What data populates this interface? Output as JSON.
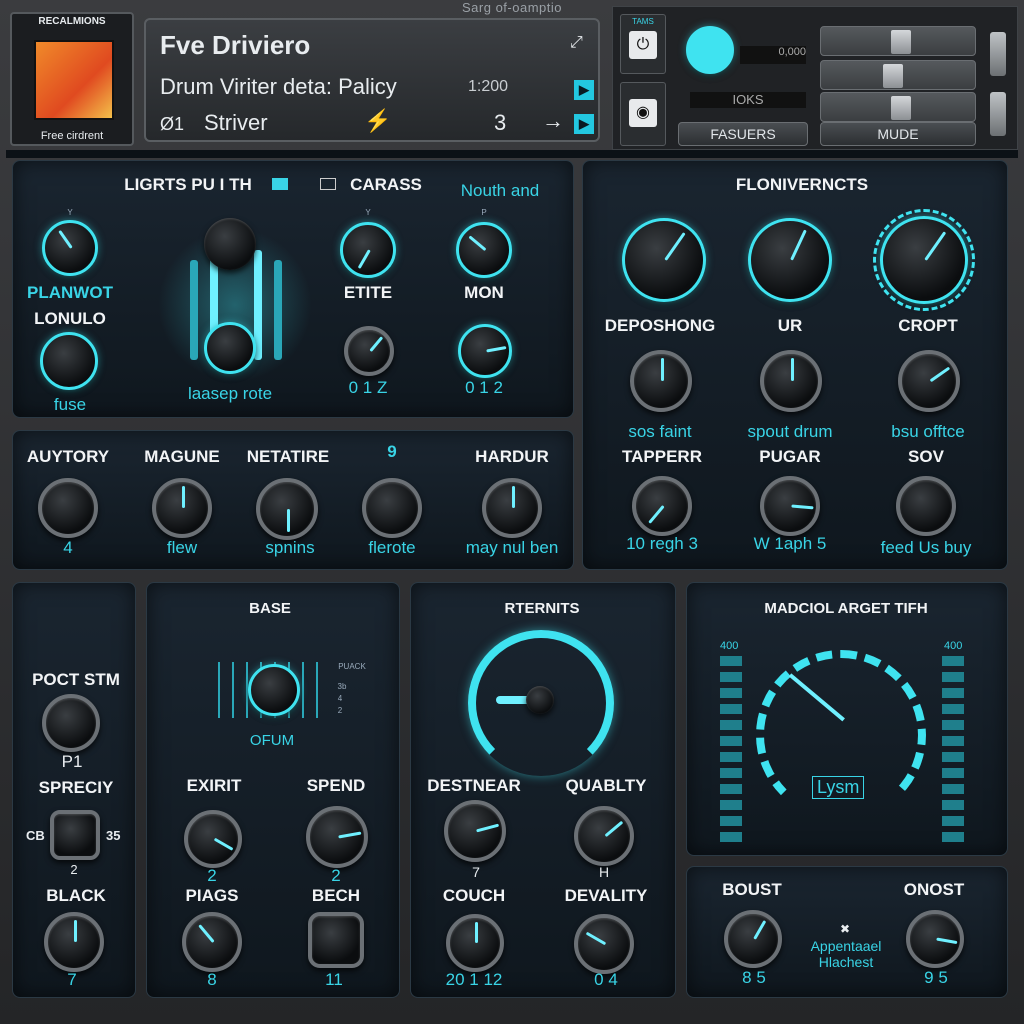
{
  "app": {
    "title": "Sarg of-oamptio"
  },
  "artwork": {
    "header": "RECALMIONS",
    "caption": "Free cirdrent"
  },
  "display": {
    "title": "Fve Driviero",
    "subtitle": "Drum Viriter deta: Palicy",
    "time": "1:200",
    "index": "Ø1",
    "preset": "Striver",
    "value": "3",
    "arrow": "→"
  },
  "top_right": {
    "faders_label": "FASUERS",
    "mode_label": "MUDE",
    "readout": "IOKS",
    "field1": "0,000",
    "btn1_label": "TAMS"
  },
  "panel1": {
    "title": "LIGRTS PU I TH",
    "option": "CARASS",
    "note": "Nouth and",
    "knobs": [
      {
        "name": "PLANWOT",
        "tick": "Y"
      },
      {
        "name": "LONULO",
        "caption": "fuse"
      },
      {
        "name": "ETITE",
        "tick": "Y",
        "scale": "0 1 Z"
      },
      {
        "name": "MON",
        "tick": "P",
        "scale": "0 1 2"
      }
    ],
    "center_caption": "laasep rote"
  },
  "panel2": {
    "knobs": [
      {
        "name": "AUYTORY",
        "caption": "4"
      },
      {
        "name": "MAGUNE",
        "caption": "flew"
      },
      {
        "name": "NETATIRE",
        "caption": "spnins"
      },
      {
        "name": "",
        "top": "9",
        "caption": "flerote"
      },
      {
        "name": "HARDUR",
        "caption": "may nul ben"
      }
    ]
  },
  "panel3": {
    "title": "FLONIVERNCTS",
    "row2": [
      {
        "name": "DEPOSHONG",
        "caption": "sos faint"
      },
      {
        "name": "UR",
        "caption": "spout drum"
      },
      {
        "name": "CROPT",
        "caption": "bsu offtce"
      }
    ],
    "row3": [
      {
        "name": "TAPPERR",
        "scale": "10 regh 3"
      },
      {
        "name": "PUGAR",
        "scale": "W 1aph 5"
      },
      {
        "name": "SOV",
        "scale": "feed Us buy"
      }
    ]
  },
  "panel4": {
    "items": [
      {
        "name": "POCT STM",
        "caption": "P1"
      },
      {
        "name": "SPRECIY",
        "left": "CB",
        "right": "35",
        "caption": "2"
      },
      {
        "name": "BLACK",
        "caption": "7"
      }
    ]
  },
  "panel5": {
    "title": "BASE",
    "caption": "OFUM",
    "side": [
      "PUACK",
      "3b",
      "4",
      "2"
    ],
    "knobs": [
      {
        "name": "EXIRIT",
        "caption": "2"
      },
      {
        "name": "SPEND",
        "caption": "2"
      },
      {
        "name": "PIAGS",
        "caption": "8"
      },
      {
        "name": "BECH",
        "caption": "11"
      }
    ]
  },
  "panel6": {
    "title": "RTERNITS",
    "knobs": [
      {
        "name": "DESTNEAR",
        "caption": "7"
      },
      {
        "name": "QUABLTY",
        "caption": "H"
      },
      {
        "name": "COUCH",
        "caption": "20 1 12"
      },
      {
        "name": "DEVALITY",
        "caption": "0 4"
      }
    ]
  },
  "panel7": {
    "title": "MADCIOL ARGET TIFH",
    "left_top": "400",
    "right_top": "400",
    "display": "Lysm"
  },
  "panel8": {
    "knobs": [
      {
        "name": "BOUST",
        "caption": "8 5"
      },
      {
        "name": "ONOST",
        "caption": "9 5"
      }
    ],
    "center": "Appentaael Hlachest"
  },
  "colors": {
    "accent": "#39d4e6",
    "bg": "#0f171e"
  }
}
